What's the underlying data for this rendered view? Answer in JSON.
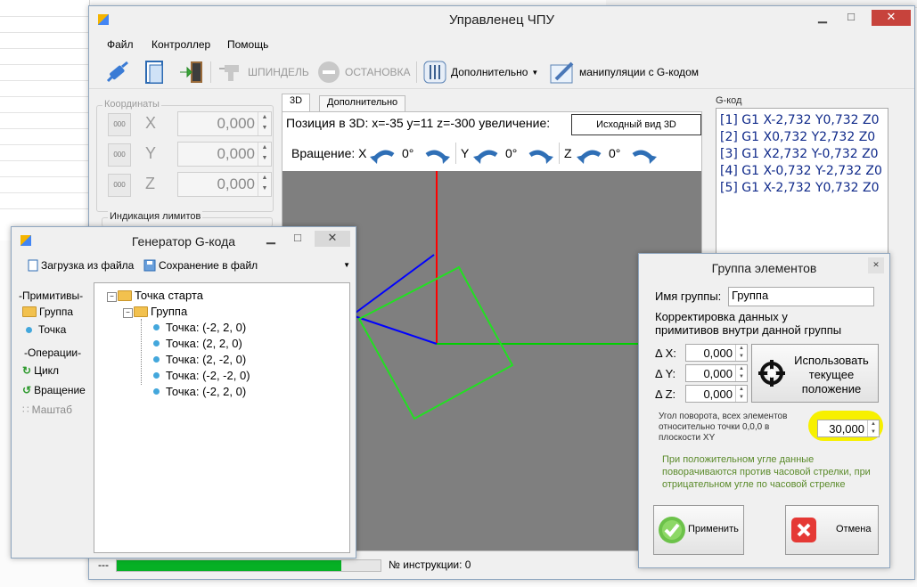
{
  "main": {
    "title": "Управленец ЧПУ",
    "menu": [
      "Файл",
      "Контроллер",
      "Помощь"
    ],
    "toolbar": {
      "spindle": "ШПИНДЕЛЬ",
      "stop": "ОСТАНОВКА",
      "additional": "Дополнительно",
      "gcode_manip": "манипуляции с G-кодом"
    },
    "coords": {
      "label": "Координаты",
      "axis_btn": "000",
      "rows": [
        {
          "axis": "X",
          "value": "0,000"
        },
        {
          "axis": "Y",
          "value": "0,000"
        },
        {
          "axis": "Z",
          "value": "0,000"
        }
      ],
      "limits_label": "Индикация лимитов"
    },
    "tabs": [
      "3D",
      "Дополнительно"
    ],
    "view3d": {
      "position_text": "Позиция в 3D: x=-35 y=11 z=-300 увеличение:",
      "origin_button": "Исходный вид 3D",
      "rotation_label": "Вращение: X",
      "rot_x": "0°",
      "axis_y": "Y",
      "rot_y": "0°",
      "axis_z": "Z",
      "rot_z": "0°"
    },
    "gcode": {
      "label": "G-код",
      "lines": [
        "[1] G1 X-2,732 Y0,732 Z0",
        "[2] G1 X0,732 Y2,732 Z0",
        "[3] G1 X2,732 Y-0,732 Z0",
        "[4] G1 X-0,732 Y-2,732 Z0",
        "[5] G1 X-2,732 Y0,732 Z0"
      ]
    },
    "status": {
      "dashes": "---",
      "progress": 0.85,
      "instruction": "№ инструкции: 0"
    }
  },
  "generator": {
    "title": "Генератор G-кода",
    "load": "Загрузка из файла",
    "save": "Сохранение в файл",
    "primitives_label": "-Примитивы-",
    "group": "Группа",
    "point": "Точка",
    "operations_label": "-Операции-",
    "cycle": "Цикл",
    "rotation": "Вращение",
    "scale": "Маштаб",
    "tree": {
      "root": "Точка старта",
      "group": "Группа",
      "points": [
        "Точка: (-2, 2, 0)",
        "Точка: (2, 2, 0)",
        "Точка: (2, -2, 0)",
        "Точка: (-2, -2, 0)",
        "Точка: (-2, 2, 0)"
      ]
    }
  },
  "group_dialog": {
    "title": "Группа элементов",
    "name_label": "Имя группы:",
    "name_value": "Группа",
    "correction_text_1": "Корректировка данных у",
    "correction_text_2": "примитивов внутри данной группы",
    "dx_label": "Δ X:",
    "dy_label": "Δ Y:",
    "dz_label": "Δ Z:",
    "dx": "0,000",
    "dy": "0,000",
    "dz": "0,000",
    "use_current_1": "Использовать",
    "use_current_2": "текущее",
    "use_current_3": "положение",
    "angle_label_1": "Угол поворота, всех элементов",
    "angle_label_2": "относительно точки 0,0,0 в",
    "angle_label_3": "плоскости XY",
    "angle_value": "30,000",
    "note_1": "При положительном угле данные",
    "note_2": "поворачиваются против часовой стрелки, при",
    "note_3": "отрицательном угле по часовой стрелке",
    "apply": "Применить",
    "cancel": "Отмена",
    "highlight_color": "#f7f000"
  }
}
